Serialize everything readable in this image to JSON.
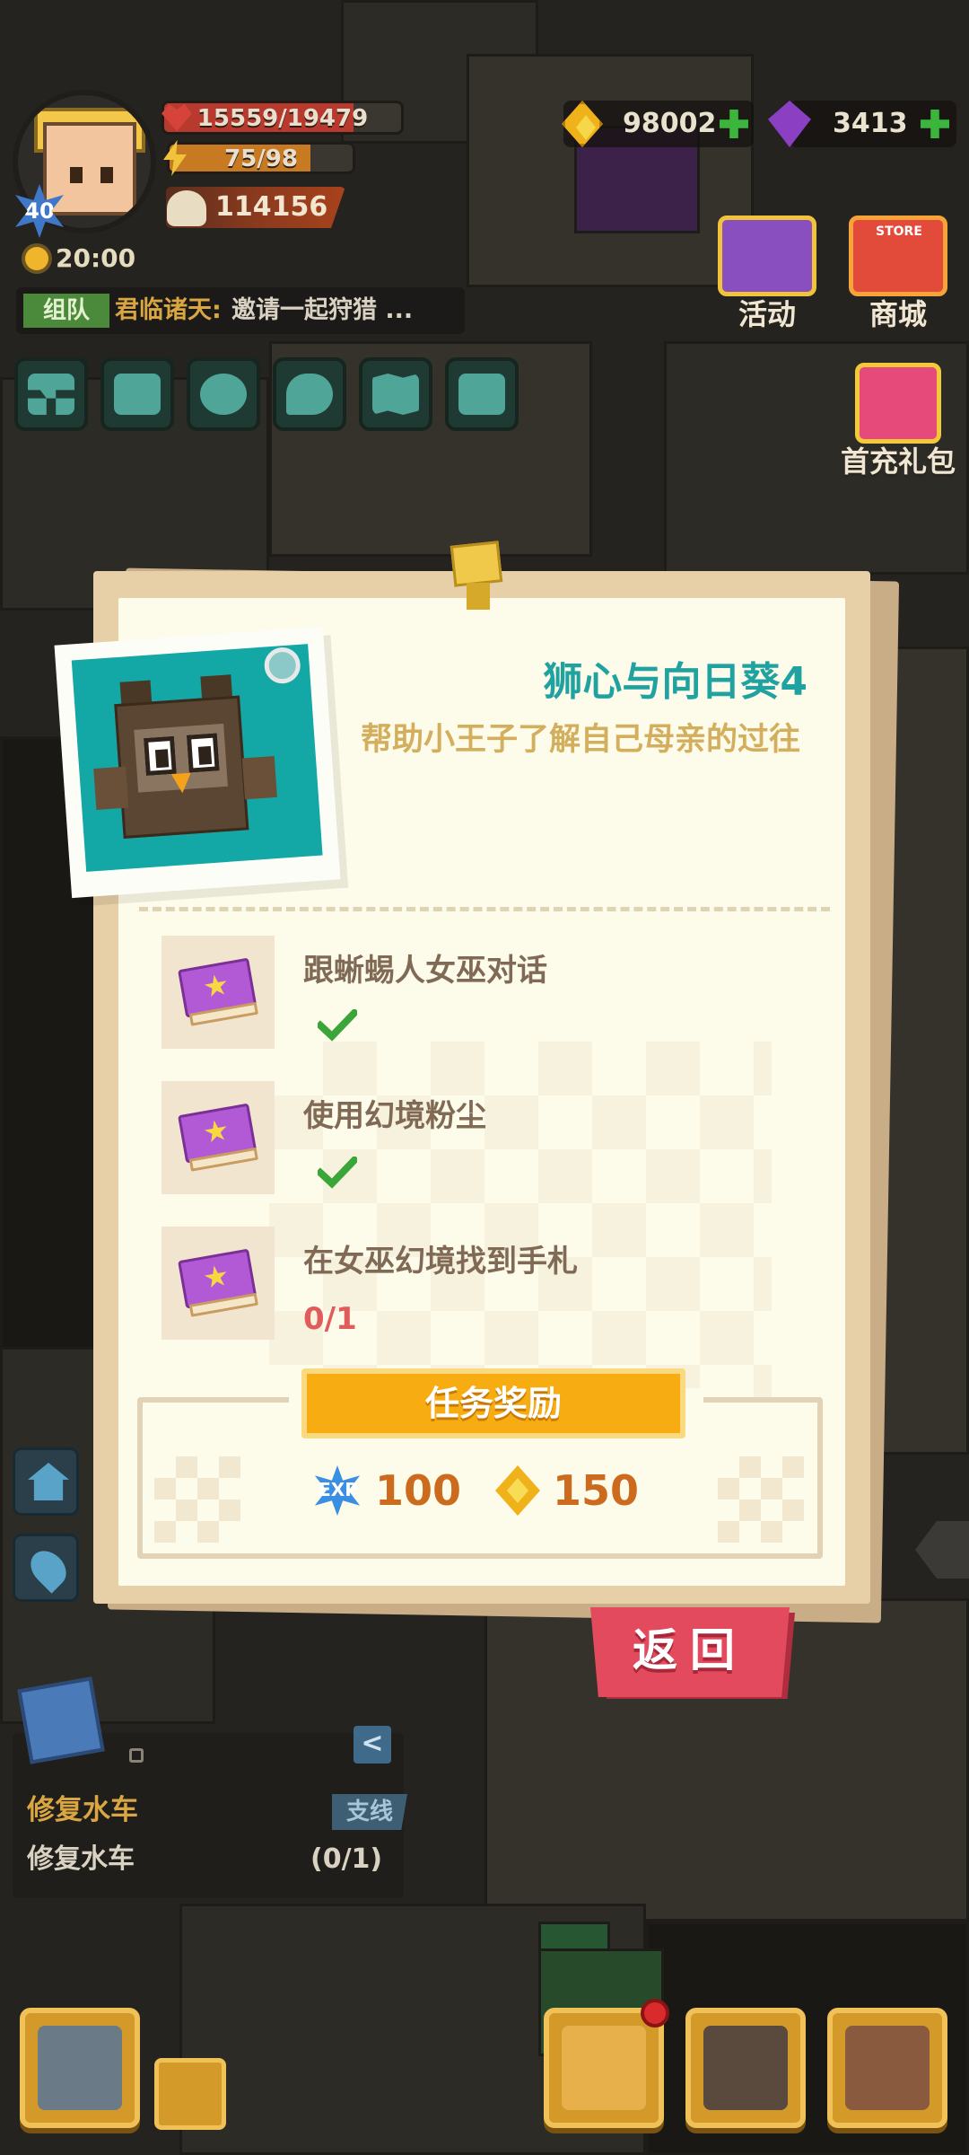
{
  "hud": {
    "level": "40",
    "hp_text": "15559/19479",
    "hp_fraction": 0.8,
    "energy_text": "75/98",
    "energy_fraction": 0.77,
    "power": "114156",
    "time": "20:00",
    "gold": "98002",
    "gems": "3413",
    "chat": {
      "tag": "组队",
      "name": "君临诸天:",
      "message": "邀请一起狩猎 ..."
    },
    "side_buttons": [
      {
        "label": "活动",
        "icon": "activity-chest-icon"
      },
      {
        "label": "商城",
        "icon": "store-icon"
      },
      {
        "label": "首充礼包",
        "icon": "gift-box-icon"
      }
    ],
    "store_small_label": "STORE"
  },
  "dialog": {
    "title": "狮心与向日葵4",
    "description": "帮助小王子了解自己母亲的过往",
    "tasks": [
      {
        "text": "跟蜥蜴人女巫对话",
        "done": true
      },
      {
        "text": "使用幻境粉尘",
        "done": true
      },
      {
        "text": "在女巫幻境找到手札",
        "progress": "0/1"
      }
    ],
    "reward_label": "任务奖励",
    "rewards": {
      "exp_icon_text": "EXP",
      "exp": "100",
      "gold": "150"
    },
    "back_label": "返回"
  },
  "tracker": {
    "title": "修复水车",
    "tag": "支线",
    "desc": "修复水车",
    "count": "(0/1)",
    "collapse": "<"
  },
  "colors": {
    "title_teal": "#20a3a0",
    "desc_gold": "#d3ae5c",
    "task_brown": "#806a55",
    "progress_red": "#e05b5b",
    "reward_orange": "#f7ac12",
    "back_red": "#e44a5e"
  }
}
